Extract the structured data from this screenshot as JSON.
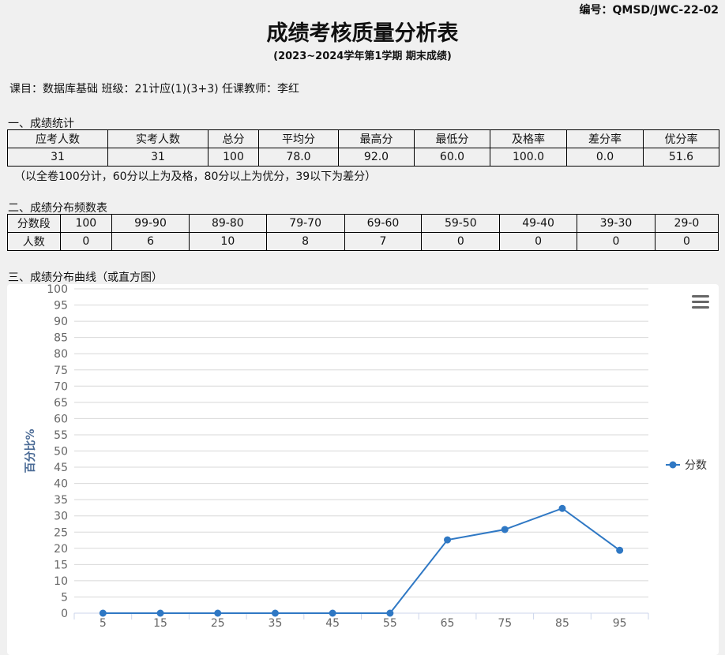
{
  "header": {
    "code": "编号：QMSD/JWC-22-02",
    "title": "成绩考核质量分析表",
    "subtitle": "(2023~2024学年第1学期  期末成绩)"
  },
  "info": {
    "course": "课目：数据库基础",
    "class_name": " 班级：21计应(1)(3+3)",
    "teacher": " 任课教师：李红"
  },
  "section1": {
    "title": "一、成绩统计",
    "headers": [
      "应考人数",
      "实考人数",
      "总分",
      "平均分",
      "最高分",
      "最低分",
      "及格率",
      "差分率",
      "优分率"
    ],
    "values": [
      "31",
      "31",
      "100",
      "78.0",
      "92.0",
      "60.0",
      "100.0",
      "0.0",
      "51.6"
    ],
    "note": "（以全卷100分计，60分以上为及格，80分以上为优分，39以下为差分）"
  },
  "section2": {
    "title": "二、成绩分布频数表",
    "row1_label": "分数段",
    "row2_label": "人数",
    "ranges": [
      "100",
      "99-90",
      "89-80",
      "79-70",
      "69-60",
      "59-50",
      "49-40",
      "39-30",
      "29-0"
    ],
    "counts": [
      "0",
      "6",
      "10",
      "8",
      "7",
      "0",
      "0",
      "0",
      "0"
    ]
  },
  "section3": {
    "title": "三、成绩分布曲线（或直方图）"
  },
  "chart_data": {
    "type": "line",
    "title": "",
    "xlabel": "",
    "ylabel": "百分比%",
    "categories": [
      "5",
      "15",
      "25",
      "35",
      "45",
      "55",
      "65",
      "75",
      "85",
      "95"
    ],
    "series": [
      {
        "name": "分数",
        "values": [
          0,
          0,
          0,
          0,
          0,
          0,
          22.6,
          25.8,
          32.3,
          19.4
        ]
      }
    ],
    "ylim": [
      0,
      100
    ],
    "ytick_step": 5,
    "grid": true,
    "legend": "right",
    "color": "#2f78c4"
  }
}
